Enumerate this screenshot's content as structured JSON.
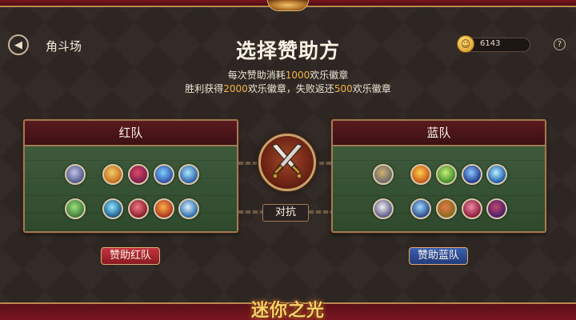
{
  "header": {
    "breadcrumb": "角斗场",
    "title": "选择赞助方",
    "coins": "6143",
    "help": "?"
  },
  "subtitle": {
    "line1_before": "每次赞助消耗",
    "line1_cost": "1000",
    "line1_after": "欢乐徽章",
    "line2_a": "胜利获得",
    "line2_win": "2000",
    "line2_b": "欢乐徽章，失败返还",
    "line2_lose": "500",
    "line2_c": "欢乐徽章"
  },
  "red_team": {
    "name": "红队",
    "sponsor_label": "赞助红队",
    "heroes": [
      {
        "color": "#4d5a8a",
        "accent": "#c7c0e8"
      },
      {
        "color": "#c46a1c",
        "accent": "#f2d06a"
      },
      {
        "color": "#7a1e4a",
        "accent": "#e0476b"
      },
      {
        "color": "#2f4fa8",
        "accent": "#7fd0ff"
      },
      {
        "color": "#2b5ea8",
        "accent": "#a8e8ff"
      },
      {
        "color": "#3f7a3a",
        "accent": "#9be07a"
      },
      {
        "color": "#1d5a8a",
        "accent": "#8fe8ff"
      },
      {
        "color": "#8a1d2a",
        "accent": "#f07a8a"
      },
      {
        "color": "#a8361c",
        "accent": "#ffb04a"
      },
      {
        "color": "#2a6aa8",
        "accent": "#d8f0ff"
      }
    ]
  },
  "blue_team": {
    "name": "蓝队",
    "sponsor_label": "赞助蓝队",
    "heroes": [
      {
        "color": "#6a6a6a",
        "accent": "#d0b070"
      },
      {
        "color": "#c4561c",
        "accent": "#ffd04a"
      },
      {
        "color": "#3f8a2a",
        "accent": "#c8f07a"
      },
      {
        "color": "#1d3a8a",
        "accent": "#8fc8ff"
      },
      {
        "color": "#1d5aa8",
        "accent": "#b8f0ff"
      },
      {
        "color": "#5a5a8a",
        "accent": "#f0f0f0"
      },
      {
        "color": "#2a4a8a",
        "accent": "#a0d8ff"
      },
      {
        "color": "#8a6a1c",
        "accent": "#e07a4a"
      },
      {
        "color": "#8a1d3a",
        "accent": "#f08aa8"
      },
      {
        "color": "#4a1d6a",
        "accent": "#c04a6a"
      }
    ]
  },
  "vs": {
    "label": "对抗"
  },
  "logo": "迷你之光"
}
